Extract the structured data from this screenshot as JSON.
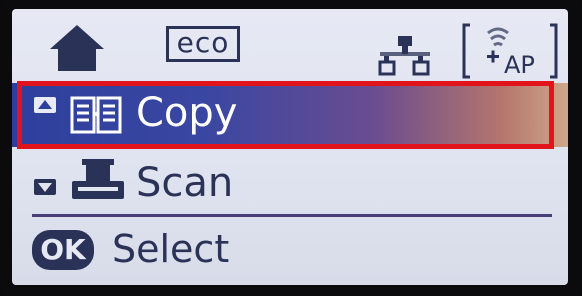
{
  "status_bar": {
    "home_icon": "home-icon",
    "eco_label": "eco",
    "network_icon": "wired-network-icon",
    "ap_icon": "wifi-direct-ap-icon",
    "ap_label": "AP"
  },
  "menu": {
    "items": [
      {
        "label": "Copy",
        "icon": "copy-icon",
        "arrow": "scroll-up-icon",
        "selected": true
      },
      {
        "label": "Scan",
        "icon": "scan-icon",
        "arrow": "scroll-down-icon",
        "selected": false
      }
    ]
  },
  "footer": {
    "ok_label": "OK",
    "action_label": "Select"
  },
  "colors": {
    "lcd_background": "#e2e6f1",
    "ink": "#2a3357",
    "selection_gradient_start": "#2d3f9c",
    "selection_gradient_end": "#cfa78a",
    "highlight_frame": "#e1141b"
  }
}
